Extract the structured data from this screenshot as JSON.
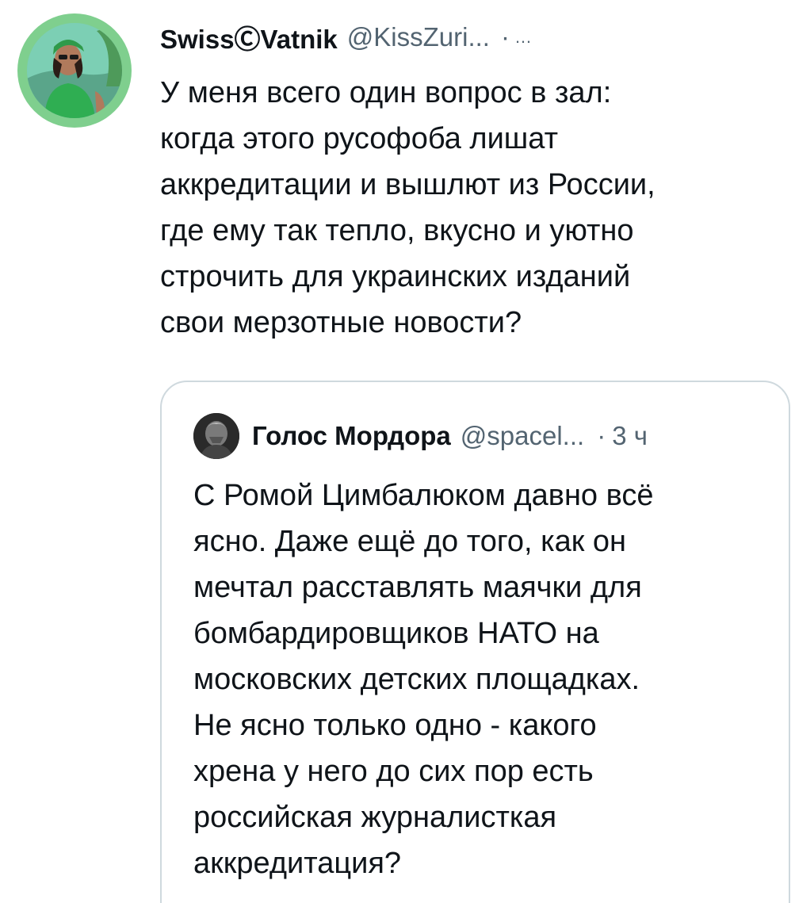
{
  "tweet": {
    "display_name": "SwissⒸVatnik",
    "handle": "@KissZuri...",
    "separator": "·",
    "timestamp": "…",
    "text": "У меня всего один вопрос в зал:\nкогда этого русофоба лишат\nаккредитации и вышлют из России,\nгде ему так тепло, вкусно и уютно\nстрочить для украинских изданий\nсвои мерзотные новости?"
  },
  "quoted_tweet": {
    "display_name": "Голос Мордора",
    "handle": "@spacel...",
    "separator": "·",
    "timestamp": "3 ч",
    "text": "С Ромой Цимбалюком давно всё\nясно. Даже ещё до того, как он\nмечтал расставлять маячки для\nбомбардировщиков НАТО на\nмосковских детских площадках.\nНе ясно только одно - какого\nхрена у него до сих пор есть\nроссийская журналисткая\nаккредитация?"
  },
  "colors": {
    "text_primary": "#0f1419",
    "text_secondary": "#536471",
    "card_border": "#cfd9de",
    "avatar_ring": "#7fcf8e"
  },
  "icons": {
    "main_avatar": "user-avatar",
    "quoted_avatar": "user-avatar"
  }
}
